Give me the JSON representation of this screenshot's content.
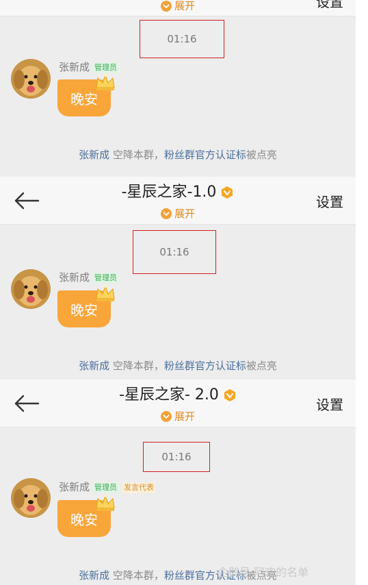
{
  "screens": [
    {
      "title": "",
      "expand": "展开",
      "settings": "设置",
      "time": "01:16",
      "sender": "张新成",
      "tags": [
        "管理员"
      ],
      "message": "晚安",
      "system": {
        "name": "张新成",
        "mid": " 空降本群，",
        "link": "粉丝群官方认证标",
        "tail": "被点亮"
      }
    },
    {
      "title": "-星辰之家-1.0",
      "expand": "展开",
      "settings": "设置",
      "time": "01:16",
      "sender": "张新成",
      "tags": [
        "管理员"
      ],
      "message": "晚安",
      "system": {
        "name": "张新成",
        "mid": " 空降本群，",
        "link": "粉丝群官方认证标",
        "tail": "被点亮"
      }
    },
    {
      "title": "-星辰之家- 2.0",
      "expand": "展开",
      "settings": "设置",
      "time": "01:16",
      "sender": "张新成",
      "tags": [
        "管理员",
        "发言代表"
      ],
      "message": "晚安",
      "system": {
        "name": "张新成",
        "mid": " 空降本群，",
        "link": "粉丝群官方认证标",
        "tail": "被点亮"
      }
    }
  ],
  "watermark": "企鹅号 阿欢的名单",
  "colors": {
    "accent": "#f8a53a",
    "link": "#4a6f9c",
    "box": "#d11e1e",
    "admin": "#3dae55",
    "speaker": "#d8922a"
  }
}
